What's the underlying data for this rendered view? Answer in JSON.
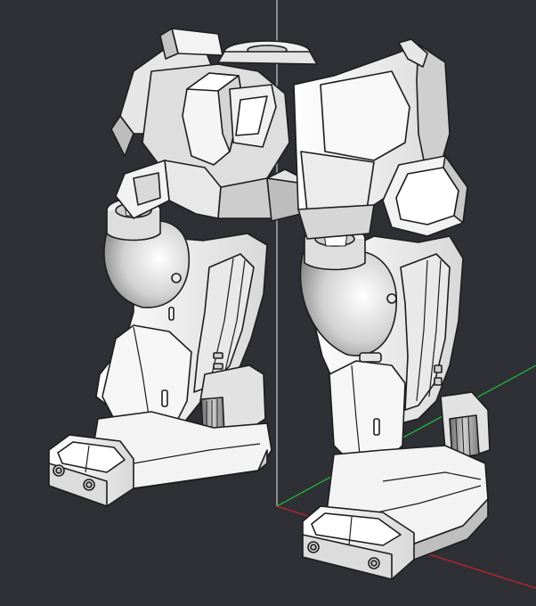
{
  "viewport": {
    "background": "#2f3035",
    "axes": {
      "x_color": "#c8232a",
      "y_color": "#1fc33a",
      "z_color": "#e6e6e6"
    }
  },
  "model": {
    "fill_light": "#f4f4f4",
    "fill_mid": "#d9d9d9",
    "fill_shade": "#b9b9b9",
    "fill_dark": "#8e8e8e",
    "edge": "#1d1d1d"
  }
}
